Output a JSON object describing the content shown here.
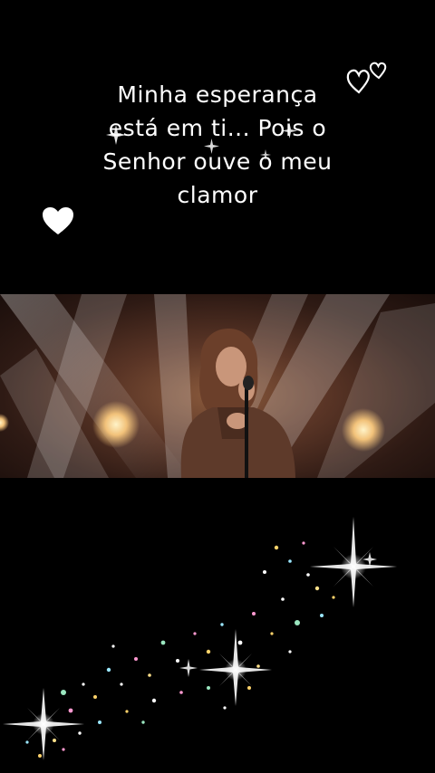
{
  "lyrics": {
    "text": "Minha esperança\nestá em ti... Pois o\nSenhor ouve o meu\nclamor"
  },
  "decorations": {
    "left_heart_icon": "solid-heart",
    "right_hearts_icon": "outline-hearts",
    "sparkle_icon": "sparkle-star"
  },
  "video": {
    "scene": "singer-at-microphone-stage-lights"
  },
  "colors": {
    "background": "#000000",
    "text": "#ffffff",
    "stage_glow": "#f2c27a"
  }
}
